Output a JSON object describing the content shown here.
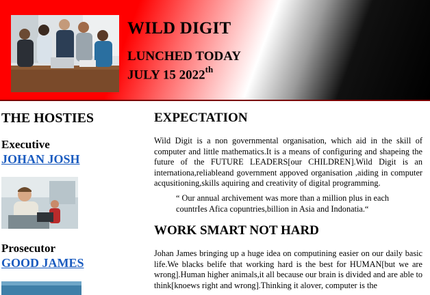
{
  "header": {
    "title": "WILD DIGIT",
    "launch_line1": "LUNCHED TODAY",
    "launch_date": "JULY 15 2022",
    "launch_date_suffix": "th",
    "photo_icon": "team-meeting-photo"
  },
  "sidebar": {
    "title": "THE HOSTIES",
    "hosts": [
      {
        "role": "Executive",
        "name": "JOHAN JOSH",
        "photo_icon": "man-at-laptop-photo"
      },
      {
        "role": "Prosecutor",
        "name": "GOOD JAMES",
        "photo_icon": "host-photo"
      }
    ]
  },
  "main": {
    "expectation_heading": "EXPECTATION",
    "expectation_text": "Wild Digit is a non governmental organisation, which aid in the skill of computer and little mathematics.It is a means of configuring and shapeing the future of the FUTURE LEADERS[our CHILDREN].Wild Digit is an internationa,reliableand government appoved organisation ,aiding in computer acqusitioning,skills aquiring and creativity of digital programming.",
    "quote_text": "“ Our annual archivement was more than a million plus in each countrIes Afica copuntries,billion in Asia and Indonatia.“",
    "work_heading": "WORK SMART NOT HARD",
    "work_text": "Johan James bringing up a huge idea on computining easier on our daily basic life.We blacks belife that working hard is the best for HUMAN[but we are wrong].Human higher animals,it all because our brain is divided and are able to think[knoews right and wrong].Thinking it alover, computer is the"
  },
  "colors": {
    "header_red": "#ff0000",
    "header_black": "#000000",
    "link_blue": "#1a5bbf"
  }
}
